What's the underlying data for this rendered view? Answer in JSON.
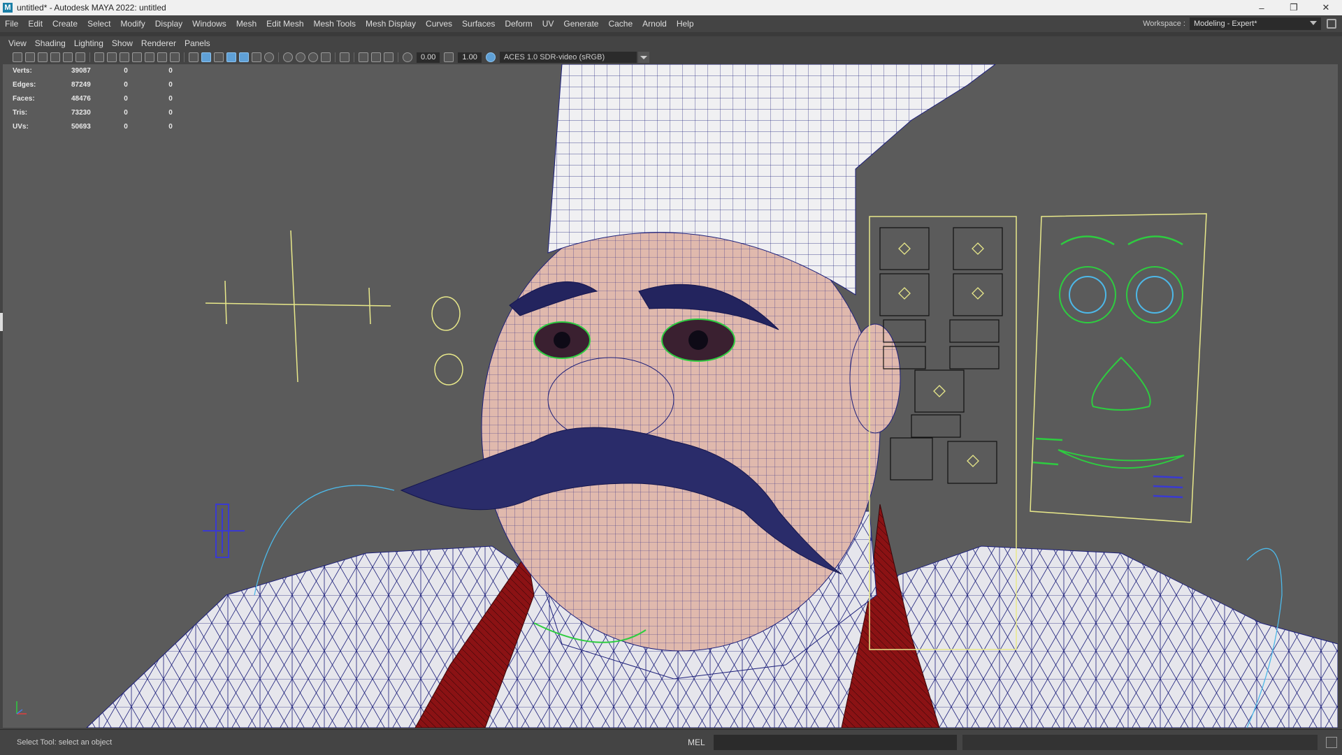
{
  "window": {
    "title": "untitled* - Autodesk MAYA 2022: untitled",
    "logo_letter": "M",
    "minimize": "–",
    "restore": "❐",
    "close": "✕"
  },
  "menu": [
    "File",
    "Edit",
    "Create",
    "Select",
    "Modify",
    "Display",
    "Windows",
    "Mesh",
    "Edit Mesh",
    "Mesh Tools",
    "Mesh Display",
    "Curves",
    "Surfaces",
    "Deform",
    "UV",
    "Generate",
    "Cache",
    "Arnold",
    "Help"
  ],
  "workspace": {
    "label": "Workspace :",
    "value": "Modeling - Expert*"
  },
  "panel_menu": [
    "View",
    "Shading",
    "Lighting",
    "Show",
    "Renderer",
    "Panels"
  ],
  "toolbar": {
    "exposure": "0.00",
    "gamma": "1.00",
    "color_space": "ACES 1.0 SDR-video (sRGB)"
  },
  "hud": [
    {
      "label": "Verts:",
      "value": "39087",
      "sel": "0",
      "comp": "0"
    },
    {
      "label": "Edges:",
      "value": "87249",
      "sel": "0",
      "comp": "0"
    },
    {
      "label": "Faces:",
      "value": "48476",
      "sel": "0",
      "comp": "0"
    },
    {
      "label": "Tris:",
      "value": "73230",
      "sel": "0",
      "comp": "0"
    },
    {
      "label": "UVs:",
      "value": "50693",
      "sel": "0",
      "comp": "0"
    }
  ],
  "status": {
    "help_line": "Select Tool: select an object",
    "mel_label": "MEL"
  },
  "colors": {
    "viewport_bg": "#5b5b5b",
    "wire": "#1c1f7a",
    "skin": "#e2bfb3",
    "coat": "#e8e8ec",
    "scarf": "#8b1214",
    "rig_yellow": "#e8e88a",
    "rig_green": "#2ecc40",
    "rig_blue": "#4db8e8"
  }
}
